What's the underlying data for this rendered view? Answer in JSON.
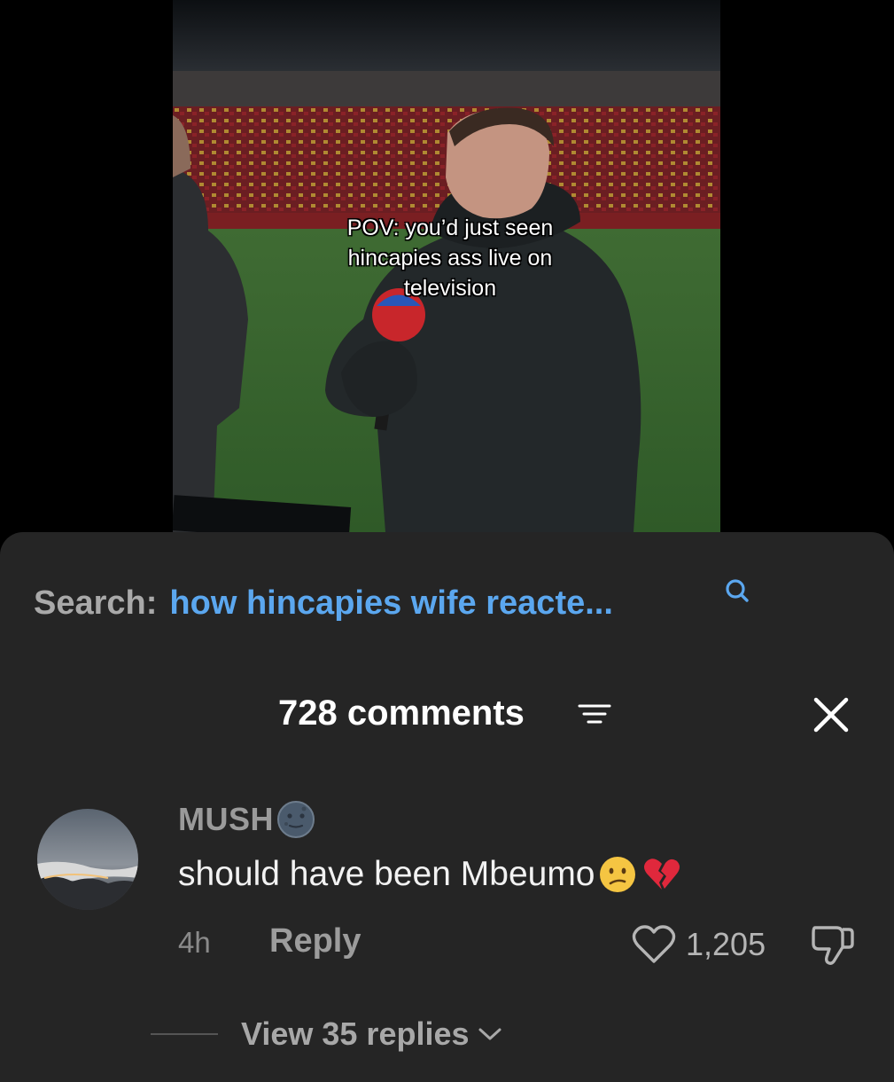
{
  "video": {
    "caption_lines": [
      "POV: you’d just seen",
      "hincapies ass live on",
      "television"
    ]
  },
  "search": {
    "prefix": "Search:",
    "query": "how hincapies wife reacte..."
  },
  "comments": {
    "count_label": "728 comments"
  },
  "comment": {
    "username": "MUSH",
    "text": "should have been Mbeumo",
    "time_ago": "4h",
    "reply_label": "Reply",
    "like_count": "1,205",
    "view_replies_label": "View 35 replies"
  },
  "colors": {
    "sheet_bg": "#252525",
    "search_query": "#5ba7ef",
    "text_primary": "#f2f2f2",
    "text_secondary": "#9a9a9a"
  },
  "icons": {
    "search": "search-icon",
    "sort": "sort-icon",
    "close": "close-icon",
    "like": "heart-outline-icon",
    "dislike": "thumbs-down-icon",
    "chevron": "chevron-down-icon"
  }
}
